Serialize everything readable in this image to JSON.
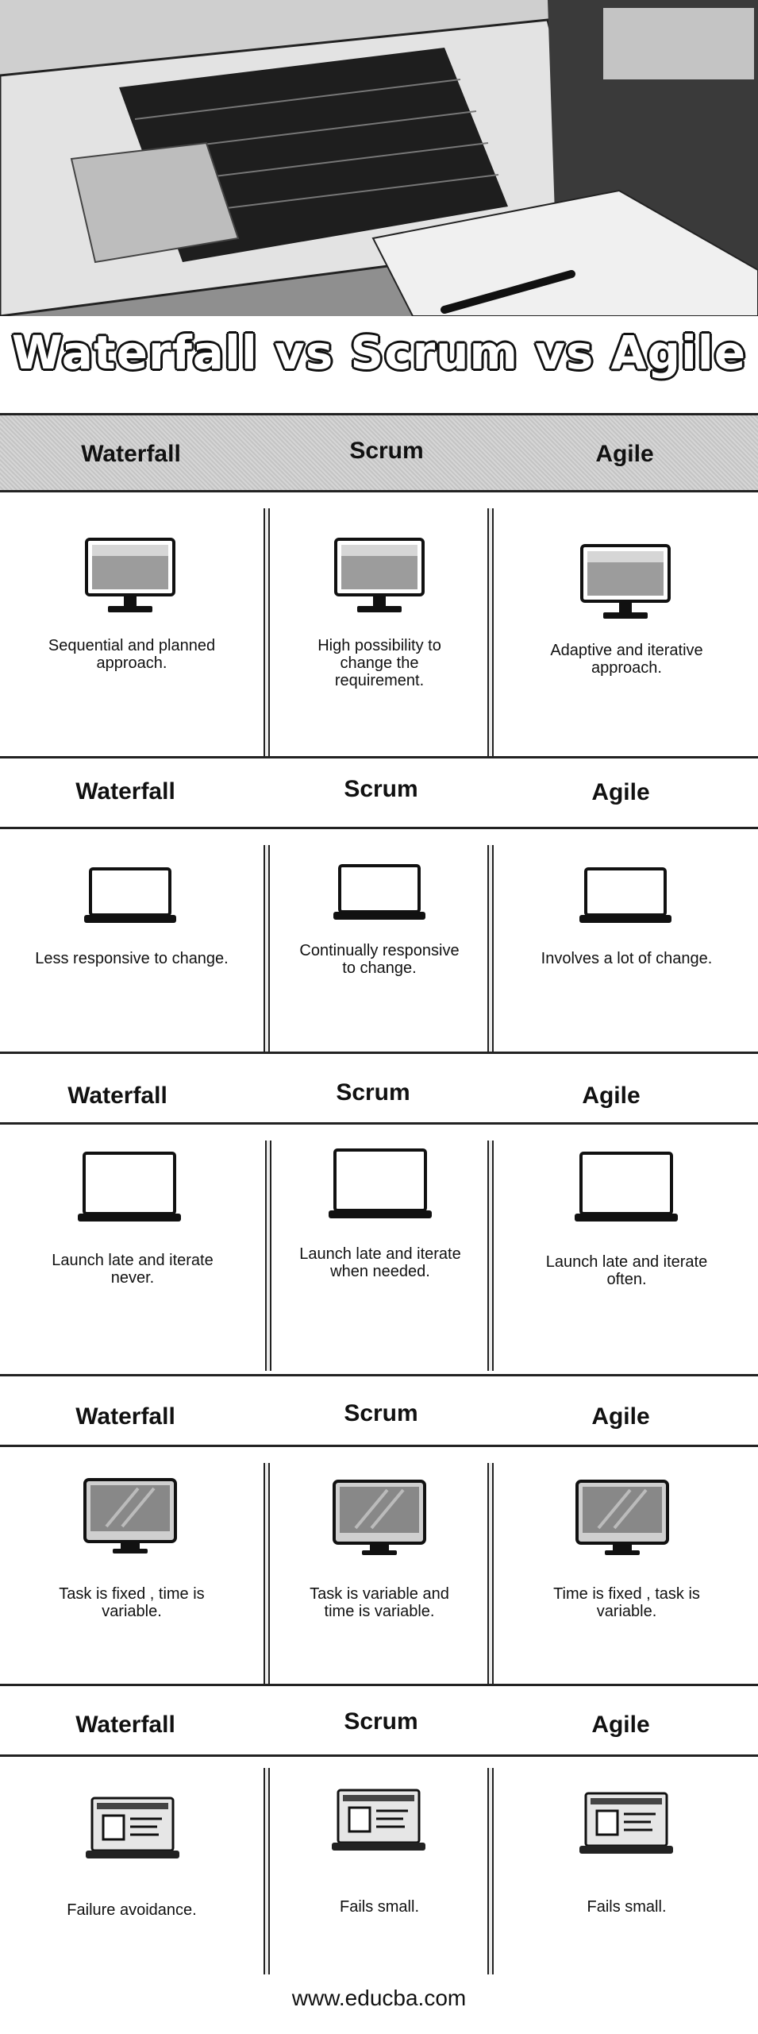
{
  "title": "Waterfall vs Scrum vs Agile",
  "columns": [
    "Waterfall",
    "Scrum",
    "Agile"
  ],
  "sections": [
    {
      "items": [
        "Sequential and planned approach.",
        "High possibility to change the requirement.",
        "Adaptive and iterative approach."
      ]
    },
    {
      "items": [
        "Less responsive to change.",
        "Continually responsive to change.",
        "Involves a lot of change."
      ]
    },
    {
      "items": [
        "Launch late and iterate never.",
        "Launch late and iterate when needed.",
        "Launch late and iterate often."
      ]
    },
    {
      "items": [
        "Task is fixed , time is variable.",
        "Task is variable and time is variable.",
        "Time is fixed , task is variable."
      ]
    },
    {
      "items": [
        "Failure avoidance.",
        "Fails small.",
        "Fails small."
      ]
    }
  ],
  "footer": "www.educba.com",
  "icons": [
    "desktop-monitor-icon",
    "laptop-icon",
    "laptop-icon",
    "imac-icon",
    "laptop-webpage-icon"
  ]
}
